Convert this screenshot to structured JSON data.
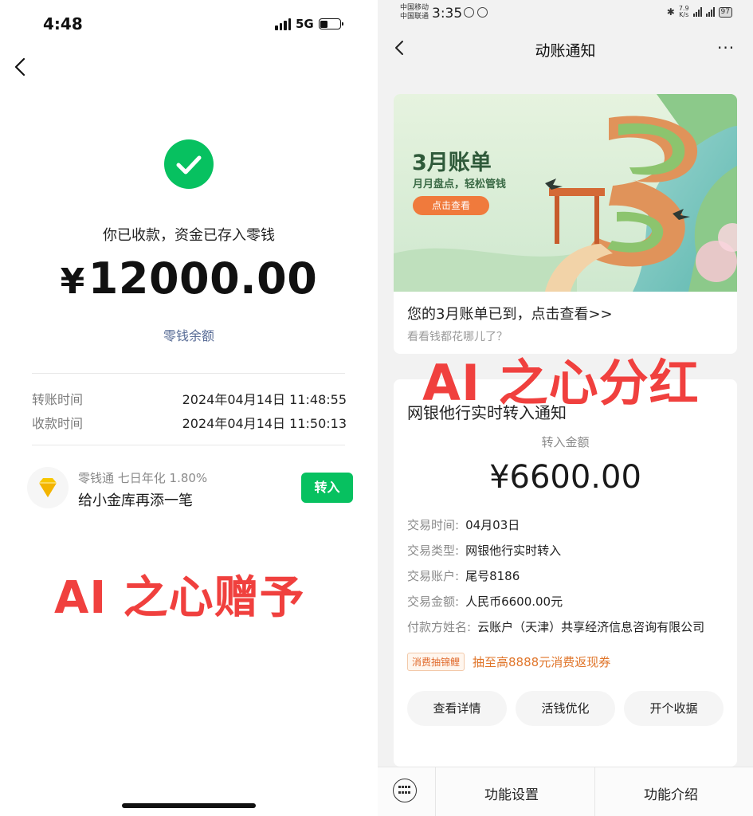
{
  "left": {
    "status_time": "4:48",
    "network": "5G",
    "received_text": "你已收款，资金已存入零钱",
    "currency": "¥",
    "amount": "12000.00",
    "balance_link": "零钱余额",
    "transfer_time_label": "转账时间",
    "transfer_time_value": "2024年04月14日 11:48:55",
    "receive_time_label": "收款时间",
    "receive_time_value": "2024年04月14日 11:50:13",
    "lqt_sub": "零钱通 七日年化 1.80%",
    "lqt_main": "给小金库再添一笔",
    "transfer_in_button": "转入",
    "watermark": "AI 之心赠予",
    "colors": {
      "accent_green": "#07c160",
      "link_blue": "#576b95",
      "watermark_red": "#f0403e"
    }
  },
  "right": {
    "carrier1": "中国移动",
    "carrier2": "中国联通",
    "status_time": "3:35",
    "speed_value": "7.9",
    "speed_unit": "K/s",
    "battery": "97",
    "nav_title": "动账通知",
    "more_icon": "···",
    "bill_banner_title": "3月账单",
    "bill_banner_sub": "月月盘点，轻松管钱",
    "bill_banner_button": "点击查看",
    "bill_line1": "您的3月账单已到，点击查看>>",
    "bill_line2": "看看钱都花哪儿了？",
    "watermark": "AI 之心分红",
    "notice": {
      "title": "网银他行实时转入通知",
      "amount_label": "转入金额",
      "amount": "¥6600.00",
      "rows": [
        {
          "label": "交易时间:",
          "value": "04月03日"
        },
        {
          "label": "交易类型:",
          "value": "网银他行实时转入"
        },
        {
          "label": "交易账户:",
          "value": "尾号8186"
        },
        {
          "label": "交易金额:",
          "value": "人民币6600.00元"
        },
        {
          "label": "付款方姓名:",
          "value": "云账户（天津）共享经济信息咨询有限公司"
        }
      ],
      "promo_badge": "消费抽锦鲤",
      "promo_text": "抽至高8888元消费返现券",
      "buttons": [
        "查看详情",
        "活钱优化",
        "开个收据"
      ]
    },
    "bottom_bar": {
      "item1": "功能设置",
      "item2": "功能介绍"
    },
    "colors": {
      "promo_orange": "#e0752a",
      "banner_button": "#f07a3c"
    }
  }
}
